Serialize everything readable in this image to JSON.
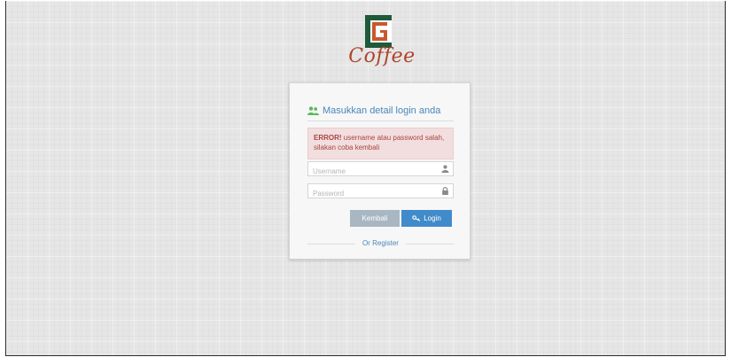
{
  "logo": {
    "text": "Coffee",
    "mark": "G"
  },
  "login": {
    "title": "Masukkan detail login anda",
    "error_label": "ERROR!",
    "error_message": " username atau password salah, silakan coba kembali",
    "username_placeholder": "Username",
    "password_placeholder": "Password",
    "back_label": "Kembali",
    "login_label": "Login",
    "register_link": "Or Register"
  },
  "colors": {
    "accent": "#428bca",
    "title": "#4a87b8",
    "error_bg": "#f2dede",
    "error_text": "#a94442",
    "logo_green": "#1f5a3a",
    "logo_orange": "#c8592c"
  },
  "icons": {
    "header": "users-icon",
    "username": "user-icon",
    "password": "lock-icon",
    "login": "key-icon"
  }
}
